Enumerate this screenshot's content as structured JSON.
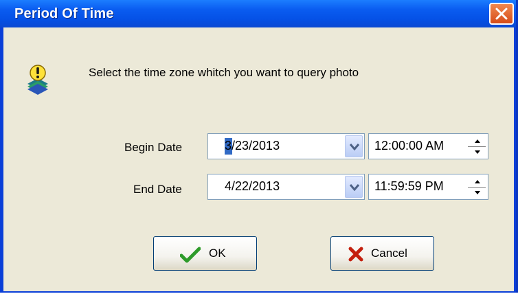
{
  "window": {
    "title": "Period Of Time"
  },
  "dialog": {
    "message": "Select the time zone whitch you want to query photo",
    "begin": {
      "label": "Begin Date",
      "date": "3/23/2013",
      "time": "12:00:00 AM"
    },
    "end": {
      "label": "End Date",
      "date": "4/22/2013",
      "time": "11:59:59 PM"
    },
    "ok_label": "OK",
    "cancel_label": "Cancel"
  },
  "icons": {
    "close": "close-icon",
    "warning": "warning-icon",
    "dropdown": "chevron-down-icon",
    "spin_up": "spin-up-icon",
    "spin_down": "spin-down-icon",
    "ok": "checkmark-icon",
    "cancel": "x-mark-icon"
  },
  "colors": {
    "titlebar": "#0a5cf0",
    "dialog_bg": "#ece9d8",
    "close": "#d64c19",
    "ok_check": "#2e9b2a",
    "cancel_x": "#c4200f",
    "selection": "#316ac5"
  }
}
